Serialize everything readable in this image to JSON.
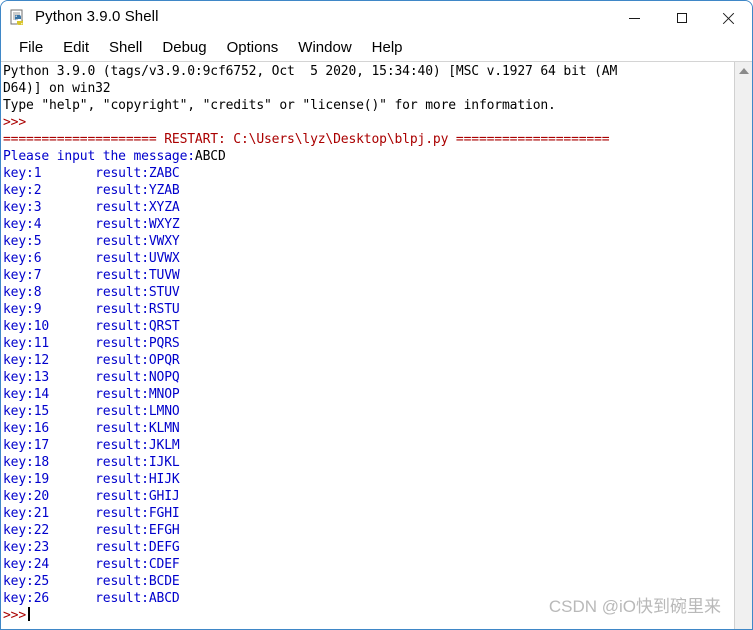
{
  "window": {
    "title": "Python 3.9.0 Shell",
    "icon": "python-idle-icon",
    "border_color": "#3f87c7",
    "buttons": {
      "minimize": "minimize-icon",
      "maximize": "maximize-icon",
      "close": "close-icon"
    }
  },
  "menubar": {
    "items": [
      {
        "label": "File"
      },
      {
        "label": "Edit"
      },
      {
        "label": "Shell"
      },
      {
        "label": "Debug"
      },
      {
        "label": "Options"
      },
      {
        "label": "Window"
      },
      {
        "label": "Help"
      }
    ]
  },
  "colors": {
    "output_blue": "#0000cc",
    "prompt_red": "#aa0000",
    "text_black": "#000000"
  },
  "console": {
    "banner": [
      "Python 3.9.0 (tags/v3.9.0:9cf6752, Oct  5 2020, 15:34:40) [MSC v.1927 64 bit (AM",
      "D64)] on win32",
      "Type \"help\", \"copyright\", \"credits\" or \"license()\" for more information."
    ],
    "prompt": ">>>",
    "restart_line": "==================== RESTART: C:\\Users\\lyz\\Desktop\\blpj.py ====================",
    "input_prompt": "Please input the message:",
    "input_value": "ABCD",
    "result_key_label": "key:",
    "result_value_label": "result:",
    "results": [
      {
        "key": "1",
        "result": "ZABC"
      },
      {
        "key": "2",
        "result": "YZAB"
      },
      {
        "key": "3",
        "result": "XYZA"
      },
      {
        "key": "4",
        "result": "WXYZ"
      },
      {
        "key": "5",
        "result": "VWXY"
      },
      {
        "key": "6",
        "result": "UVWX"
      },
      {
        "key": "7",
        "result": "TUVW"
      },
      {
        "key": "8",
        "result": "STUV"
      },
      {
        "key": "9",
        "result": "RSTU"
      },
      {
        "key": "10",
        "result": "QRST"
      },
      {
        "key": "11",
        "result": "PQRS"
      },
      {
        "key": "12",
        "result": "OPQR"
      },
      {
        "key": "13",
        "result": "NOPQ"
      },
      {
        "key": "14",
        "result": "MNOP"
      },
      {
        "key": "15",
        "result": "LMNO"
      },
      {
        "key": "16",
        "result": "KLMN"
      },
      {
        "key": "17",
        "result": "JKLM"
      },
      {
        "key": "18",
        "result": "IJKL"
      },
      {
        "key": "19",
        "result": "HIJK"
      },
      {
        "key": "20",
        "result": "GHIJ"
      },
      {
        "key": "21",
        "result": "FGHI"
      },
      {
        "key": "22",
        "result": "EFGH"
      },
      {
        "key": "23",
        "result": "DEFG"
      },
      {
        "key": "24",
        "result": "CDEF"
      },
      {
        "key": "25",
        "result": "BCDE"
      },
      {
        "key": "26",
        "result": "ABCD"
      }
    ]
  },
  "scrollbar": {
    "up_arrow": "triangle-up-icon"
  },
  "watermark": {
    "text": "CSDN @iO快到碗里来"
  }
}
